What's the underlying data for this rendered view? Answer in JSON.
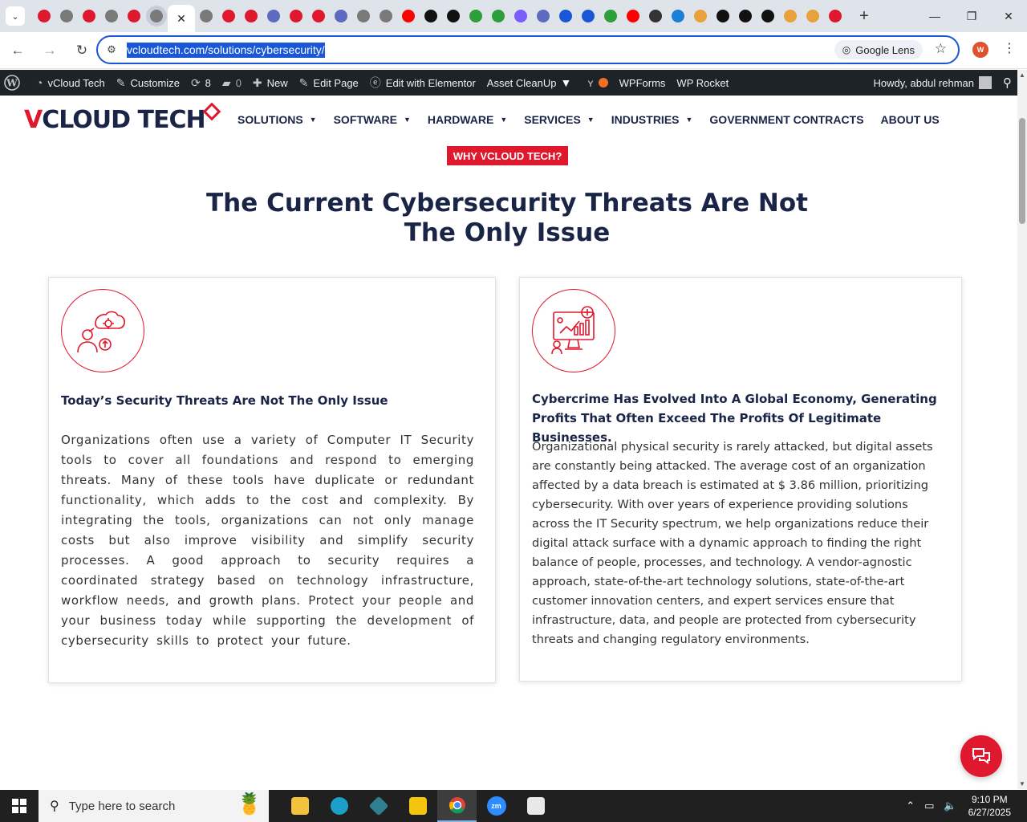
{
  "browser": {
    "tab_count_shown": 37,
    "active_tab_close": "✕",
    "new_tab": "+",
    "window": {
      "minimize": "—",
      "restore": "❐",
      "close": "✕"
    },
    "url": "vcloudtech.com/solutions/cybersecurity/",
    "lens_label": "Google Lens",
    "profile_initial": "W"
  },
  "adminbar": {
    "site_name": "vCloud Tech",
    "customize": "Customize",
    "updates_count": "8",
    "comments_count": "0",
    "new": "New",
    "edit_page": "Edit Page",
    "edit_elementor": "Edit with Elementor",
    "asset_cleanup": "Asset CleanUp",
    "wpforms": "WPForms",
    "wp_rocket": "WP Rocket",
    "howdy": "Howdy, abdul rehman"
  },
  "site": {
    "logo_v": "V",
    "logo_rest": "CLOUD TECH",
    "nav": [
      "SOLUTIONS",
      "SOFTWARE",
      "HARDWARE",
      "SERVICES",
      "INDUSTRIES",
      "GOVERNMENT CONTRACTS",
      "ABOUT US"
    ],
    "why_button": "WHY VCLOUD TECH?",
    "hero_title_line1": "The Current Cybersecurity Threats Are Not",
    "hero_title_line2": "The Only Issue",
    "card1": {
      "title": "Today’s Security Threats Are Not The Only Issue",
      "body": "Organizations often use a variety of Computer IT Security tools to cover all foundations and respond to emerging threats. Many of these tools have duplicate or redundant functionality, which adds to the cost and complexity. By integrating the tools, organizations can not only manage costs but also improve visibility and simplify security processes. A good approach to security requires a coordinated strategy based on technology infrastructure, workflow needs, and growth plans. Protect your people and your business today while supporting the development of cybersecurity skills to protect your future."
    },
    "card2": {
      "title": "Cybercrime Has Evolved Into A Global Economy, Generating Profits That Often Exceed The Profits Of Legitimate Businesses.",
      "body": "Organizational physical security is rarely attacked, but digital assets are constantly being attacked. The average cost of an organization affected by a data breach is estimated at $ 3.86 million, prioritizing cybersecurity. With over years of experience providing solutions across the IT Security spectrum, we help organizations reduce their digital attack surface with a dynamic approach to finding the right balance of people, processes, and technology. A vendor-agnostic approach, state-of-the-art technology solutions, state-of-the-art customer innovation centers, and expert services ensure that infrastructure, data, and people are protected from cybersecurity threats and changing regulatory environments."
    }
  },
  "taskbar": {
    "search_placeholder": "Type here to search",
    "time": "9:10 PM",
    "date": "6/27/2025"
  },
  "colors": {
    "brand_red": "#e0182d",
    "brand_navy": "#1a2446",
    "adminbar": "#1d2327",
    "taskbar": "#202020",
    "focus_blue": "#1a57d6"
  }
}
